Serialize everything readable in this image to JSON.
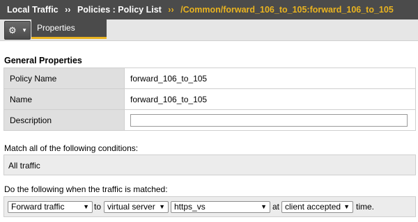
{
  "breadcrumb": {
    "root": "Local Traffic",
    "sep1": "››",
    "section": "Policies : Policy List",
    "sep2": "››",
    "current": "/Common/forward_106_to_105:forward_106_to_105"
  },
  "toolbar": {
    "gear_icon": "⚙",
    "caret": "▼",
    "tab_properties": "Properties"
  },
  "general": {
    "title": "General Properties",
    "rows": [
      {
        "label": "Policy Name",
        "value": "forward_106_to_105"
      },
      {
        "label": "Name",
        "value": "forward_106_to_105"
      },
      {
        "label": "Description",
        "value": ""
      }
    ]
  },
  "conditions": {
    "label": "Match all of the following conditions:",
    "value": "All traffic"
  },
  "actions": {
    "label": "Do the following when the traffic is matched:",
    "action_select": "Forward traffic",
    "to_text": "to",
    "target_select": "virtual server",
    "server_select": "https_vs",
    "at_text": "at",
    "event_select": "client accepted",
    "time_text": "time."
  },
  "colors": {
    "accent": "#e9b320",
    "header_bg": "#4b4b4b"
  }
}
